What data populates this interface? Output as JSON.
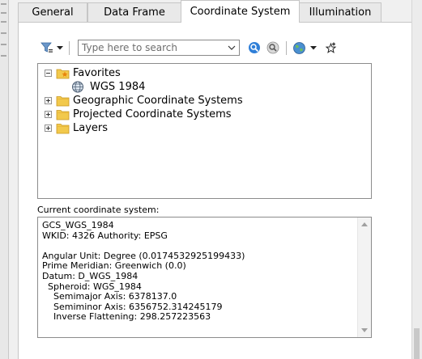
{
  "tabs": [
    {
      "label": "General"
    },
    {
      "label": "Data Frame"
    },
    {
      "label": "Coordinate System",
      "active": true
    },
    {
      "label": "Illumination"
    }
  ],
  "toolbar": {
    "search_placeholder": "Type here to search",
    "icons": [
      "filter-icon",
      "dropdown-arrow-icon",
      "search-icon",
      "clear-search-icon",
      "globe-icon",
      "dropdown-arrow-icon",
      "add-favorite-icon"
    ]
  },
  "tree": {
    "favorites": {
      "label": "Favorites",
      "children": [
        {
          "label": "WGS 1984"
        }
      ]
    },
    "items": [
      {
        "label": "Geographic Coordinate Systems"
      },
      {
        "label": "Projected Coordinate Systems"
      },
      {
        "label": "Layers"
      }
    ]
  },
  "current": {
    "label": "Current coordinate system:",
    "lines": [
      "GCS_WGS_1984",
      "WKID: 4326 Authority: EPSG",
      "",
      "Angular Unit: Degree (0.0174532925199433)",
      "Prime Meridian: Greenwich (0.0)",
      "Datum: D_WGS_1984",
      "  Spheroid: WGS_1984",
      "    Semimajor Axis: 6378137.0",
      "    Semiminor Axis: 6356752.314245179",
      "    Inverse Flattening: 298.257223563"
    ]
  },
  "colors": {
    "folder": "#f2c94c",
    "folder_dark": "#d9a520",
    "globe": "#4a8fd0",
    "search": "#2f7fd8"
  }
}
